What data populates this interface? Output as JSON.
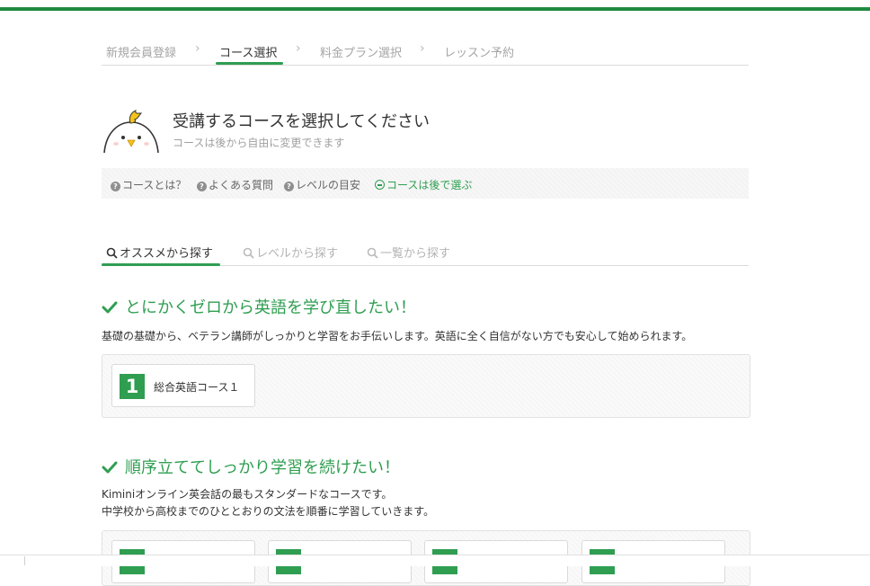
{
  "steps": [
    {
      "label": "新規会員登録",
      "active": false
    },
    {
      "label": "コース選択",
      "active": true
    },
    {
      "label": "料金プラン選択",
      "active": false
    },
    {
      "label": "レッスン予約",
      "active": false
    }
  ],
  "header": {
    "title": "受講するコースを選択してください",
    "subtitle": "コースは後から自由に変更できます"
  },
  "help_links": [
    "コースとは？",
    "よくある質問",
    "レベルの目安",
    "コースは後で選ぶ"
  ],
  "tabs": [
    {
      "label": "オススメから探す",
      "active": true
    },
    {
      "label": "レベルから探す",
      "active": false
    },
    {
      "label": "一覧から探す",
      "active": false
    }
  ],
  "sections": [
    {
      "title": "とにかくゼロから英語を学び直したい！",
      "description": [
        "基礎の基礎から、ベテラン講師がしっかりと学習をお手伝いします。英語に全く自信がない方でも安心して始められます。"
      ],
      "courses": [
        {
          "number": "1",
          "name": "総合英語コース１"
        }
      ]
    },
    {
      "title": "順序立ててしっかり学習を続けたい！",
      "description": [
        "Kiminiオンライン英会話の最もスタンダードなコースです。",
        "中学校から高校までのひととおりの文法を順番に学習していきます。"
      ],
      "courses": []
    }
  ],
  "colors": {
    "accent": "#2f9e51",
    "top_bar": "#1f8a3f"
  }
}
